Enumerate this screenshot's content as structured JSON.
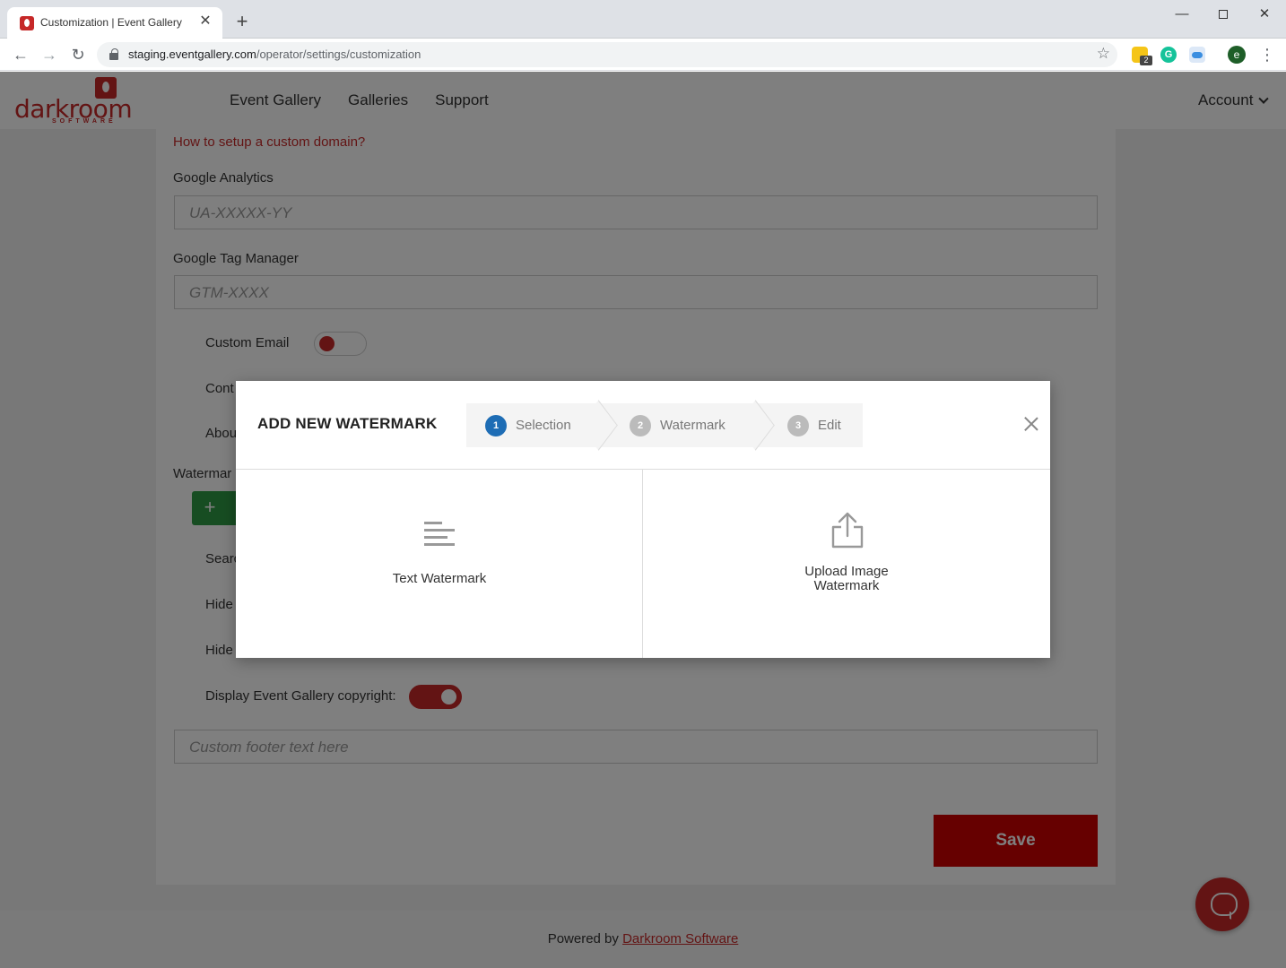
{
  "browser": {
    "tab_title": "Customization | Event Gallery",
    "url_host": "staging.eventgallery.com",
    "url_path": "/operator/settings/customization",
    "ext_badge": "2",
    "profile_initial": "e"
  },
  "header": {
    "logo_text": "darkroom",
    "logo_sub": "SOFTWARE",
    "nav": [
      "Event Gallery",
      "Galleries",
      "Support"
    ],
    "account": "Account"
  },
  "form": {
    "custom_domain_link": "How to setup a custom domain?",
    "google_analytics_label": "Google Analytics",
    "google_analytics_placeholder": "UA-XXXXX-YY",
    "gtm_label": "Google Tag Manager",
    "gtm_placeholder": "GTM-XXXX",
    "custom_email_label": "Custom Email",
    "contact_label_partial": "Cont",
    "about_label_partial": "Abou",
    "watermark_label_partial": "Watermar",
    "add_button": "+",
    "search_label_partial": "Searc",
    "hide1_label_partial": "Hide",
    "hide2_label_partial": "Hide",
    "copyright_label": "Display Event Gallery copyright:",
    "footer_placeholder": "Custom footer text here",
    "save": "Save"
  },
  "footer": {
    "prefix": "Powered by",
    "link": "Darkroom Software"
  },
  "modal": {
    "title": "ADD NEW WATERMARK",
    "steps": [
      {
        "num": "1",
        "label": "Selection"
      },
      {
        "num": "2",
        "label": "Watermark"
      },
      {
        "num": "3",
        "label": "Edit"
      }
    ],
    "options": {
      "text": "Text Watermark",
      "upload_line1": "Upload Image",
      "upload_line2": "Watermark"
    }
  },
  "colors": {
    "brand_red": "#c62828",
    "step_active": "#1e6db5",
    "add_green": "#2e9a45"
  }
}
